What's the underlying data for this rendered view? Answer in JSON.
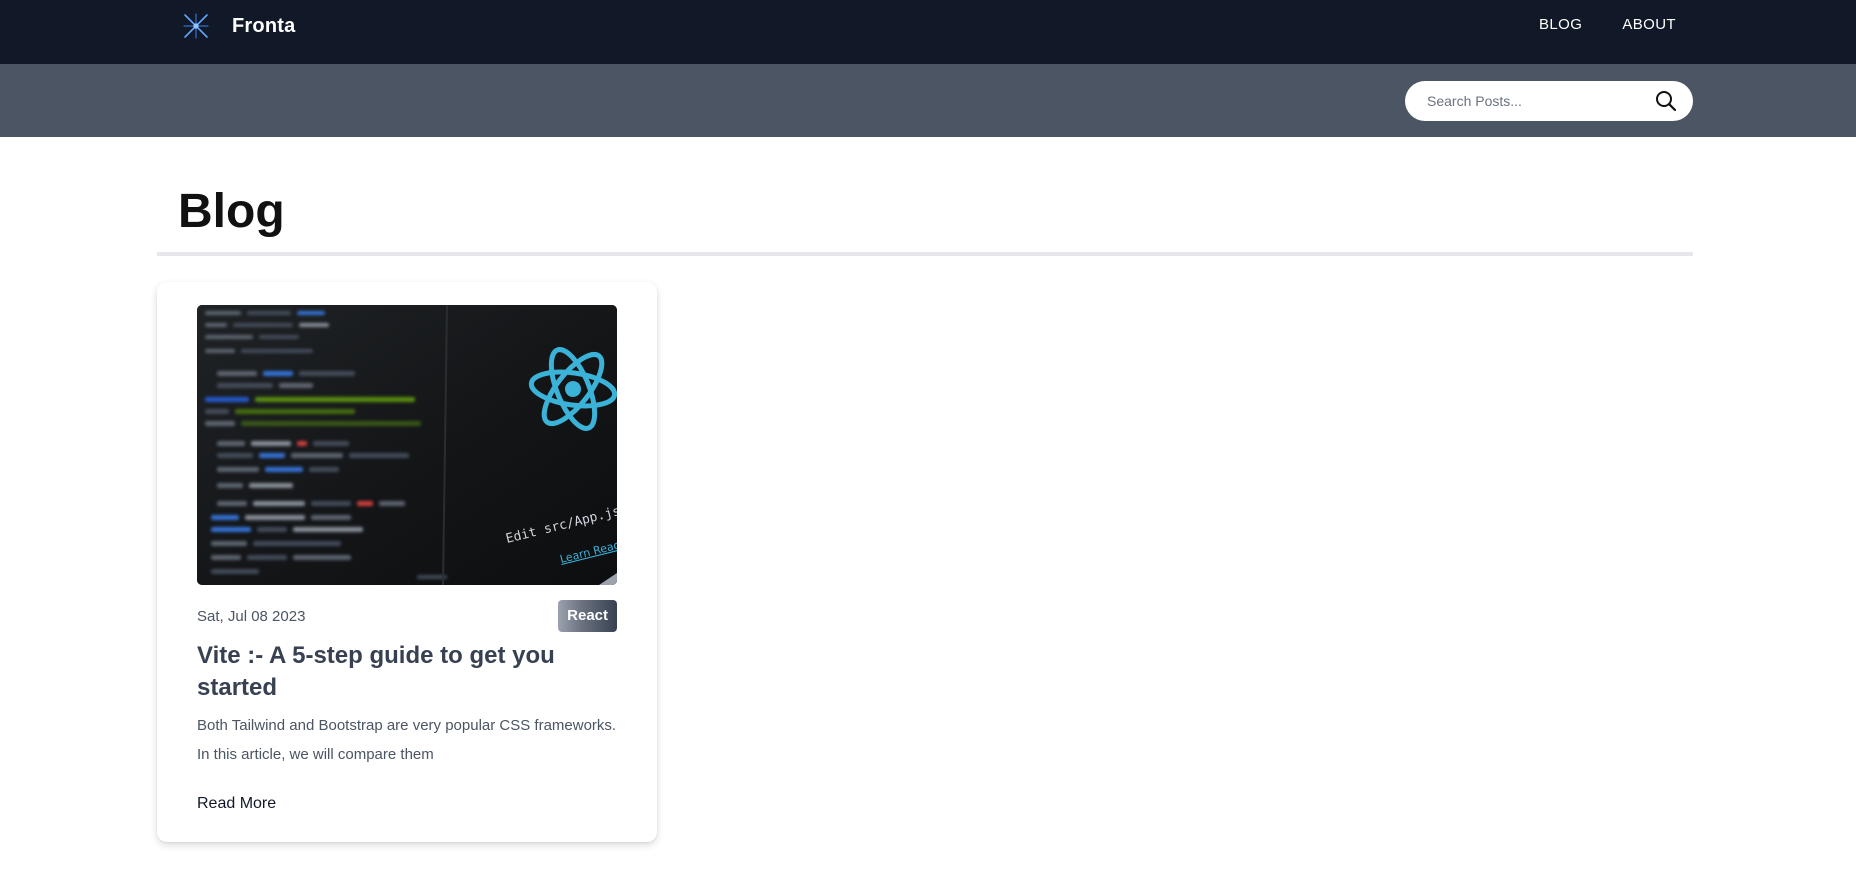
{
  "header": {
    "brand_name": "Fronta",
    "nav": [
      {
        "label": "BLOG"
      },
      {
        "label": "ABOUT"
      }
    ]
  },
  "search": {
    "placeholder": "Search Posts..."
  },
  "main": {
    "title": "Blog"
  },
  "posts": [
    {
      "date": "Sat, Jul 08 2023",
      "tag": "React",
      "title": "Vite :- A 5-step guide to get you started",
      "excerpt": "Both Tailwind and Bootstrap are very popular CSS frameworks. In this article, we will compare them",
      "read_more": "Read More",
      "image_text_1": "Edit src/App.js and save to",
      "image_text_2": "Learn React"
    }
  ],
  "colors": {
    "topbar": "#111827",
    "searchbar": "#4b5563",
    "react_blue": "#3bb2d8"
  },
  "icons": {
    "brand": "crossed-lines-logo-icon",
    "search": "search-icon",
    "react": "react-atom-icon"
  }
}
